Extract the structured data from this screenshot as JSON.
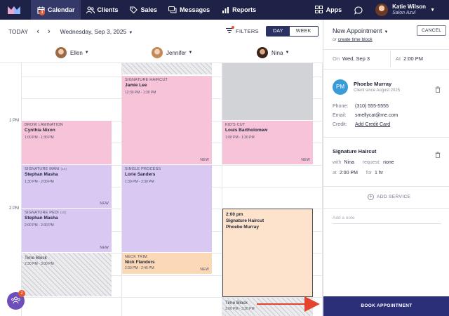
{
  "nav": {
    "items": [
      {
        "label": "Calendar",
        "icon": "calendar-icon",
        "active": true,
        "badge": "1"
      },
      {
        "label": "Clients",
        "icon": "users-icon"
      },
      {
        "label": "Sales",
        "icon": "tag-icon"
      },
      {
        "label": "Messages",
        "icon": "chat-icon"
      },
      {
        "label": "Reports",
        "icon": "bar-chart-icon"
      }
    ],
    "apps_label": "Apps",
    "user_name": "Katie Wilson",
    "user_salon": "Salon Azul"
  },
  "toolbar": {
    "today": "TODAY",
    "date": "Wednesday, Sep 3, 2025",
    "filters": "FILTERS",
    "view_day": "DAY",
    "view_week": "WEEK"
  },
  "staff": [
    "Ellen",
    "Jennifer",
    "Nina"
  ],
  "times": [
    "1 PM",
    "2 PM"
  ],
  "appointments": {
    "brow": {
      "service": "BROW LAMINATION",
      "client": "Cynthia Nixon",
      "time": "1:00 PM - 1:30 PM"
    },
    "mani": {
      "service": "SIGNATURE MANI",
      "tag": "(10)",
      "client": "Stephan Masha",
      "time": "1:30 PM - 2:00 PM",
      "new": "NEW"
    },
    "pedi": {
      "service": "SIGNATURE PEDI",
      "tag": "(10)",
      "client": "Stephan Masha",
      "time": "2:00 PM - 2:30 PM",
      "new": "NEW"
    },
    "block1": {
      "client": "Time Block",
      "time": "2:30 PM - 3:00 PM"
    },
    "haircut": {
      "service": "SIGNATURE HAIRCUT",
      "client": "Jamie Lee",
      "time": "12:30 PM - 1:30 PM",
      "new": "NEW"
    },
    "process": {
      "service": "SINGLE PROCESS",
      "client": "Lorie Sanders",
      "time": "1:30 PM - 2:30 PM"
    },
    "neck": {
      "service": "NECK TRIM",
      "client": "Nick Flanders",
      "time": "2:30 PM - 2:45 PM",
      "new": "NEW"
    },
    "kids": {
      "service": "KID'S CUT",
      "client": "Louis Bartholomew",
      "time": "1:00 PM - 1:30 PM",
      "new": "NEW"
    },
    "draft": {
      "time": "2:00 pm",
      "service": "Signature Haircut",
      "client": "Phoebe Murray"
    },
    "block2": {
      "client": "Time Block",
      "time": "3:00 PM - 3:30 PM"
    }
  },
  "fab_badge": "2",
  "panel": {
    "title": "New Appointment",
    "sub_or": "or",
    "sub_link": "create time block",
    "cancel": "CANCEL",
    "on_label": "On",
    "date": "Wed, Sep 3",
    "at_label": "At",
    "time": "2:00 PM",
    "client_initials": "PM",
    "client_name": "Phoebe Murray",
    "client_since": "Client since August 2025",
    "phone_label": "Phone:",
    "phone": "(310) 555-5555",
    "email_label": "Email:",
    "email": "smellycat@me.com",
    "credit_label": "Credit:",
    "credit_link": "Add Credit Card",
    "service_name": "Signature Haircut",
    "with_label": "with",
    "with_value": "Nina",
    "request_label": "request:",
    "request_value": "none",
    "at_label2": "at",
    "service_time": "2:00 PM",
    "for_label": "for",
    "duration": "1 hr",
    "add_service": "ADD SERVICE",
    "note_placeholder": "Add a note",
    "book": "BOOK APPOINTMENT"
  },
  "colors": {
    "nav_bg": "#1e2246",
    "pink": "#f7c3d9",
    "purple": "#d9c8f2",
    "peach": "#fbd9b7",
    "book_button": "#2b2f78",
    "arrow": "#e4432e"
  }
}
